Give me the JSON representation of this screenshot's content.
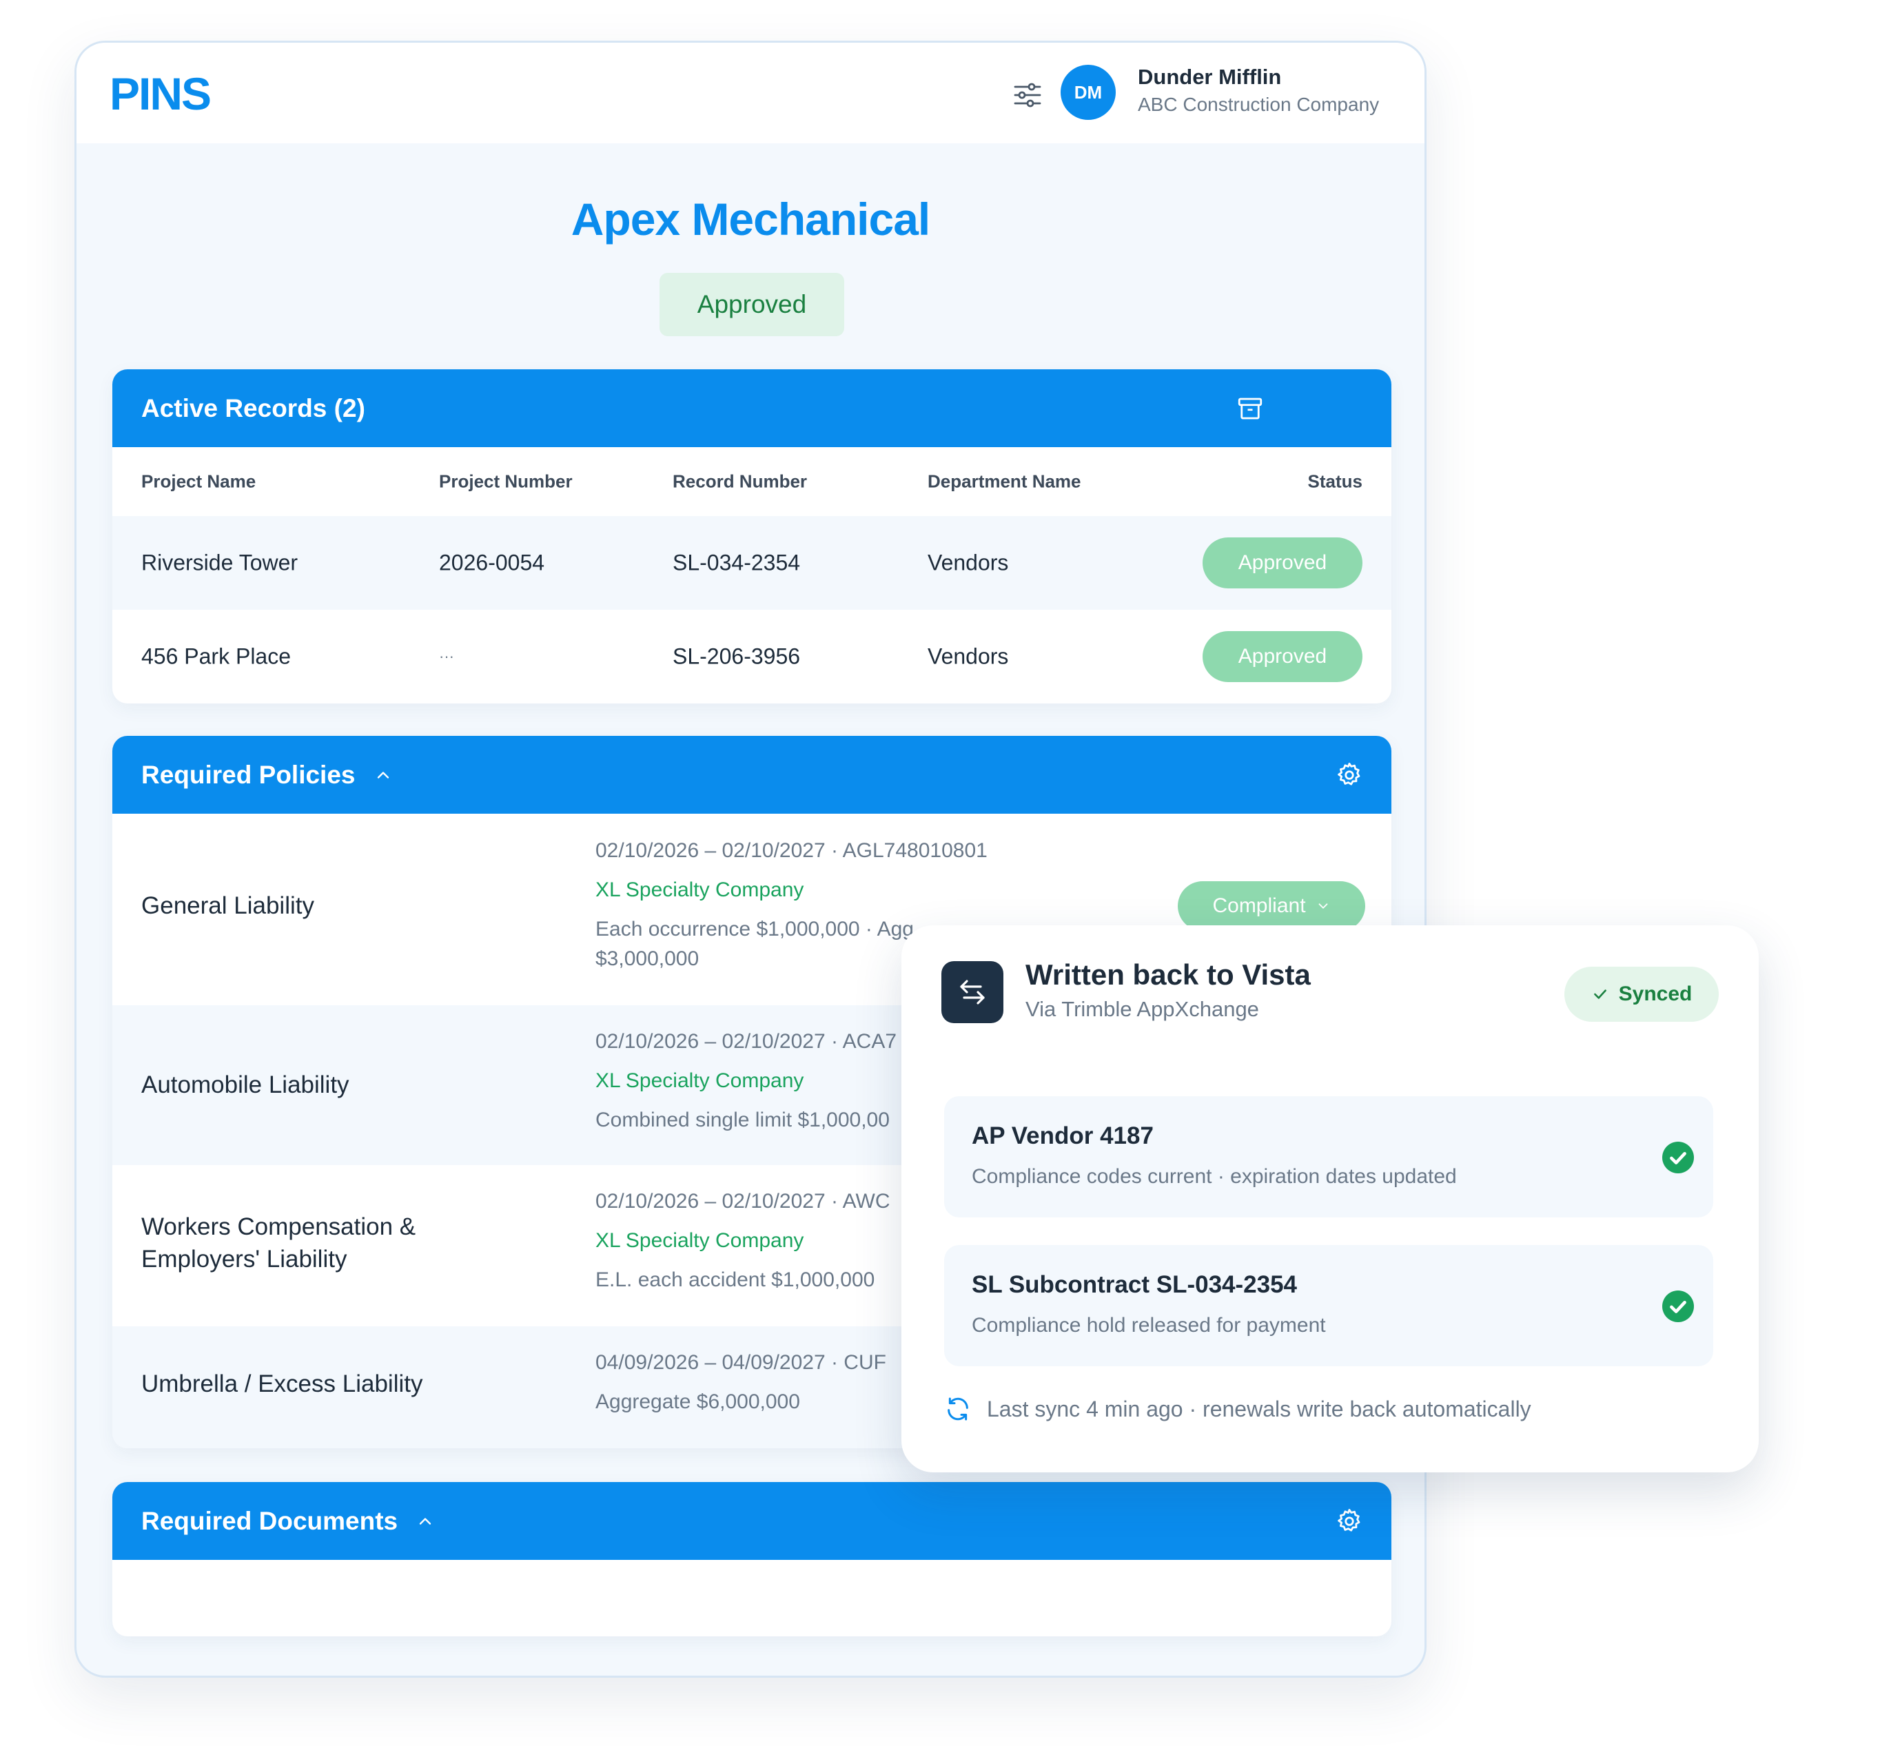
{
  "header": {
    "logo": "PINS",
    "filter_icon": "sliders-icon",
    "avatar_initials": "DM",
    "user_name": "Dunder Mifflin",
    "user_company": "ABC Construction Company"
  },
  "page": {
    "title": "Apex Mechanical",
    "status": "Approved"
  },
  "active_records": {
    "title": "Active Records (2)",
    "action_icon": "archive-icon",
    "columns": [
      "Project Name",
      "Project Number",
      "Record Number",
      "Department Name",
      "Status"
    ],
    "rows": [
      {
        "project_name": "Riverside Tower",
        "project_number": "2026-0054",
        "record_number": "SL-034-2354",
        "department": "Vendors",
        "status": "Approved"
      },
      {
        "project_name": "456 Park Place",
        "project_number": "···",
        "record_number": "SL-206-3956",
        "department": "Vendors",
        "status": "Approved"
      }
    ]
  },
  "required_policies": {
    "title": "Required Policies",
    "action_icon": "gear-icon",
    "items": [
      {
        "name_line1": "General Liability",
        "name_line2": "",
        "dates": "02/10/2026 – 02/10/2027 · AGL748010801",
        "insurer": "XL Specialty Company",
        "limits": "Each occurrence $1,000,000 · Agg",
        "limits2": "$3,000,000",
        "status": "Compliant"
      },
      {
        "name_line1": "Automobile Liability",
        "name_line2": "",
        "dates": "02/10/2026 – 02/10/2027 · ACA7",
        "insurer": "XL Specialty Company",
        "limits": "Combined single limit $1,000,00",
        "limits2": ""
      },
      {
        "name_line1": "Workers Compensation &",
        "name_line2": "Employers' Liability",
        "dates": "02/10/2026 – 02/10/2027 · AWC",
        "insurer": "XL Specialty Company",
        "limits": "E.L. each accident $1,000,000",
        "limits2": ""
      },
      {
        "name_line1": "Umbrella / Excess Liability",
        "name_line2": "",
        "dates": "04/09/2026 – 04/09/2027 · CUF",
        "insurer": "",
        "limits": "Aggregate $6,000,000",
        "limits2": ""
      }
    ]
  },
  "required_documents": {
    "title": "Required Documents",
    "action_icon": "gear-icon"
  },
  "sync_popup": {
    "icon": "swap-arrows-icon",
    "title": "Written back to Vista",
    "subtitle": "Via Trimble AppXchange",
    "badge": "Synced",
    "items": [
      {
        "title": "AP Vendor 4187",
        "detail": "Compliance codes current · expiration dates updated"
      },
      {
        "title": "SL Subcontract SL-034-2354",
        "detail": "Compliance hold released for payment"
      }
    ],
    "footer": "Last sync 4 min ago · renewals write back automatically"
  },
  "colors": {
    "brand_blue": "#0a8ced",
    "approved_pill": "#8ed9ae",
    "success_green": "#1aa35e",
    "dark_icon_bg": "#1e3145"
  }
}
